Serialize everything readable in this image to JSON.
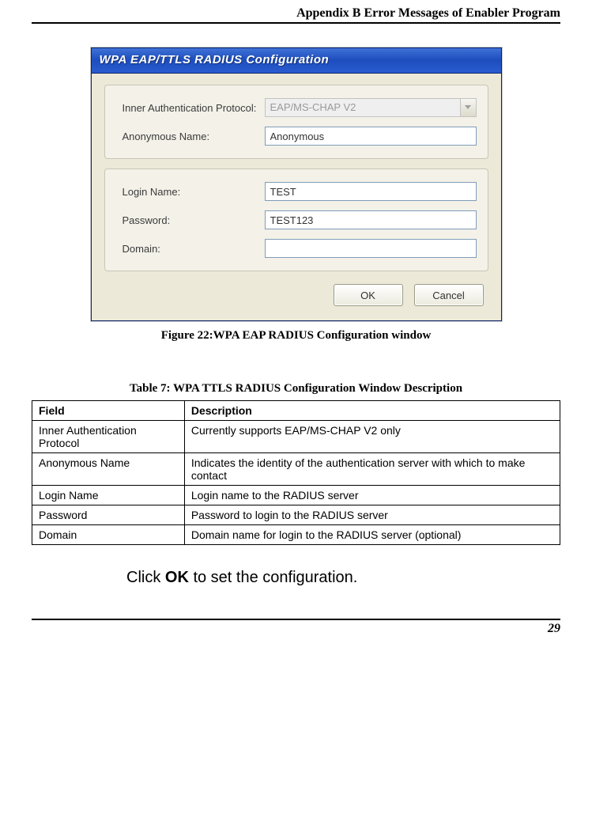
{
  "header": {
    "title": "Appendix B Error Messages of Enabler Program"
  },
  "dialog": {
    "title": "WPA EAP/TTLS RADIUS Configuration",
    "group1": {
      "inner_auth_label": "Inner Authentication Protocol:",
      "inner_auth_value": "EAP/MS-CHAP V2",
      "anon_label": "Anonymous Name:",
      "anon_value": "Anonymous"
    },
    "group2": {
      "login_label": "Login Name:",
      "login_value": "TEST",
      "password_label": "Password:",
      "password_value": "TEST123",
      "domain_label": "Domain:",
      "domain_value": ""
    },
    "buttons": {
      "ok": "OK",
      "cancel": "Cancel"
    }
  },
  "figure_caption": "Figure 22:WPA EAP RADIUS Configuration window",
  "table_caption": "Table 7: WPA TTLS RADIUS Configuration Window Description",
  "table": {
    "headers": {
      "field": "Field",
      "desc": "Description"
    },
    "rows": [
      {
        "field": "Inner Authentication Protocol",
        "desc": "Currently supports EAP/MS-CHAP V2 only"
      },
      {
        "field": "Anonymous Name",
        "desc": "Indicates the identity of the authentication server with which to make contact"
      },
      {
        "field": "Login Name",
        "desc": "Login name to the RADIUS server"
      },
      {
        "field": "Password",
        "desc": "Password to login to the RADIUS server"
      },
      {
        "field": "Domain",
        "desc": "Domain name for login to the RADIUS server (optional)"
      }
    ]
  },
  "instruction": {
    "pre": "Click ",
    "bold": "OK",
    "post": " to set the configuration."
  },
  "page_number": "29"
}
